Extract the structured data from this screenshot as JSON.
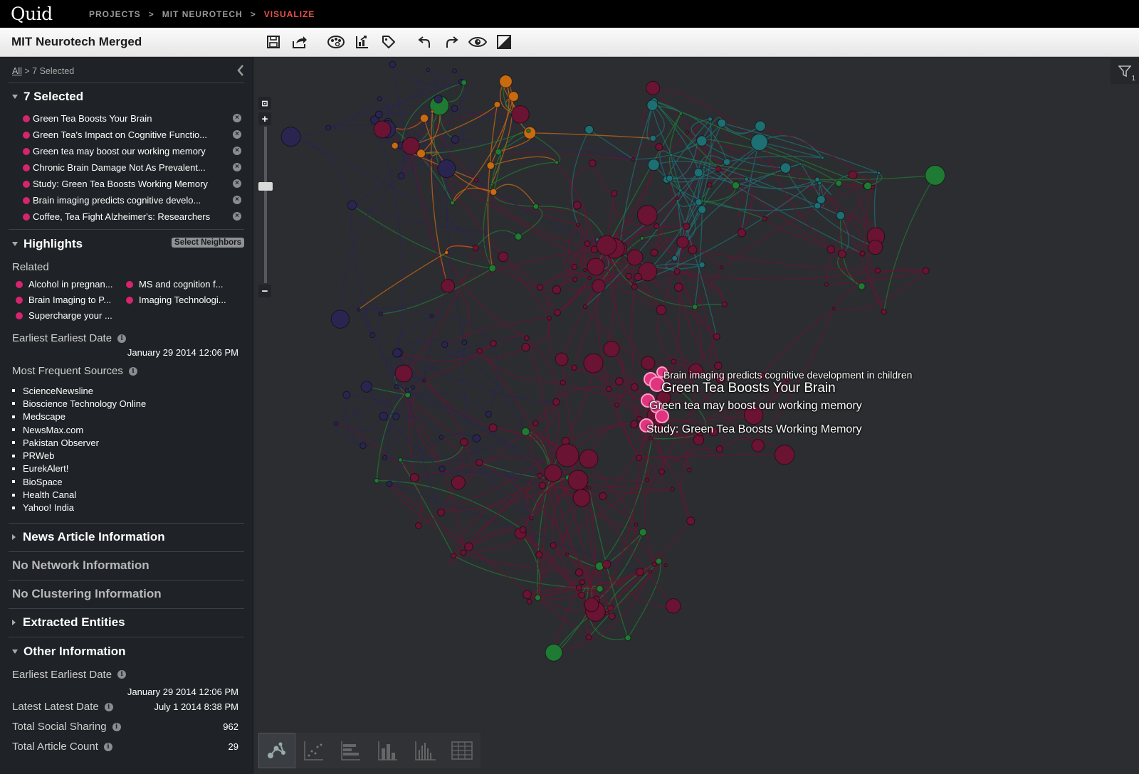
{
  "app": {
    "logo": "Quid"
  },
  "breadcrumb": {
    "items": [
      "PROJECTS",
      "MIT NEUROTECH",
      "VISUALIZE"
    ],
    "separator": ">"
  },
  "toolbar": {
    "title": "MIT Neurotech Merged",
    "buttons": [
      "save-icon",
      "export-icon",
      "palette-icon",
      "chart-export-icon",
      "tag-icon",
      "undo-icon",
      "redo-icon",
      "eye-icon",
      "contrast-icon"
    ]
  },
  "sidebar": {
    "crumb_all": "All",
    "crumb_rest": " > 7 Selected",
    "selected": {
      "title": "7 Selected",
      "items": [
        "Green Tea Boosts Your Brain",
        "Green Tea's Impact on Cognitive Functio...",
        "Green tea may boost our working memory",
        "Chronic Brain Damage Not As Prevalent...",
        "Study: Green Tea Boosts Working Memory",
        "Brain imaging predicts cognitive develo...",
        "Coffee, Tea Fight Alzheimer's: Researchers"
      ]
    },
    "highlights": {
      "title": "Highlights",
      "select_neighbors": "Select Neighbors",
      "related_label": "Related",
      "related": [
        "Alcohol in pregnan...",
        "MS and cognition f...",
        "Brain Imaging to P...",
        "Imaging Technologi...",
        "Supercharge your ..."
      ],
      "earliest_label": "Earliest Earliest Date",
      "earliest_value": "January 29 2014 12:06 PM",
      "sources_label": "Most Frequent Sources",
      "sources": [
        "ScienceNewsline",
        "Bioscience Technology Online",
        "Medscape",
        "NewsMax.com",
        "Pakistan Observer",
        "PRWeb",
        "EurekAlert!",
        "BioSpace",
        "Health Canal",
        "Yahoo! India"
      ]
    },
    "sections": {
      "news_article": "News Article Information",
      "no_network": "No Network Information",
      "no_clustering": "No Clustering Information",
      "extracted": "Extracted Entities",
      "other": "Other Information"
    },
    "other": {
      "earliest_label": "Earliest Earliest Date",
      "earliest_value": "January 29 2014 12:06 PM",
      "latest_label": "Latest Latest Date",
      "latest_value": "July 1 2014 8:38 PM",
      "social_label": "Total Social Sharing",
      "social_value": "962",
      "count_label": "Total Article Count",
      "count_value": "29"
    }
  },
  "canvas": {
    "labels": [
      "Brain imaging predicts cognitive development in children",
      "Green Tea Boosts Your Brain",
      "Green tea may boost our working memory",
      "Study: Green Tea Boosts Working Memory"
    ],
    "filter_count": "1",
    "view_modes": [
      "network-view-icon",
      "scatter-view-icon",
      "timeline-view-icon",
      "bar-chart-view-icon",
      "histogram-view-icon",
      "table-view-icon"
    ]
  },
  "colors": {
    "selected_node": "#e0347f",
    "cluster_crimson": "#6a1332",
    "cluster_navy": "#2a2550",
    "cluster_teal": "#1d6f73",
    "cluster_orange": "#c86a12",
    "cluster_green": "#1f7a33",
    "accent": "#e8534a"
  }
}
